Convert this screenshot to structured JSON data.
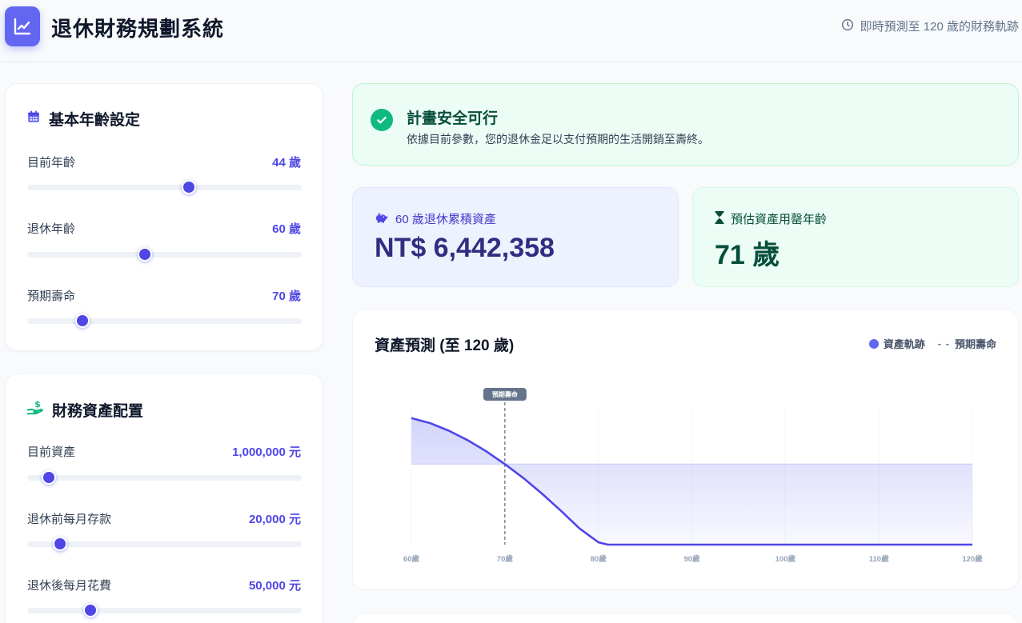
{
  "header": {
    "title": "退休財務規劃系統",
    "subtitle": "即時預測至 120 歲的財務軌跡"
  },
  "age_settings": {
    "title": "基本年齡設定",
    "fields": [
      {
        "label": "目前年齡",
        "value": "44 歲",
        "level": 0.59
      },
      {
        "label": "退休年齡",
        "value": "60 歲",
        "level": 0.43
      },
      {
        "label": "預期壽命",
        "value": "70 歲",
        "level": 0.2
      }
    ]
  },
  "finance_settings": {
    "title": "財務資產配置",
    "fields": [
      {
        "label": "目前資產",
        "value": "1,000,000 元",
        "level": 0.08
      },
      {
        "label": "退休前每月存款",
        "value": "20,000 元",
        "level": 0.12
      },
      {
        "label": "退休後每月花費",
        "value": "50,000 元",
        "level": 0.23
      }
    ]
  },
  "alert": {
    "title": "計畫安全可行",
    "description": "依據目前參數，您的退休金足以支付預期的生活開銷至壽終。"
  },
  "stats": {
    "accumulated": {
      "label": "60  歲退休累積資產",
      "value": "NT$ 6,442,358"
    },
    "depletion": {
      "label": "預估資產用罄年齡",
      "value": "71 歲"
    }
  },
  "chart": {
    "title": "資產預測 (至 120 歲)",
    "legend_series": "資產軌跡",
    "legend_expectancy": "預期壽命",
    "expectancy_tag": "預期壽命"
  },
  "colors": {
    "accent": "#4f46e5",
    "line": "#4f46e5",
    "success": "#10b981"
  },
  "chart_data": {
    "type": "area",
    "x": [
      60,
      62,
      64,
      66,
      68,
      70,
      72,
      74,
      76,
      78,
      80,
      81,
      90,
      100,
      110,
      120
    ],
    "series": [
      {
        "name": "資產軌跡",
        "values": [
          6442358,
          6180000,
          5800000,
          5320000,
          4750000,
          4100000,
          3380000,
          2580000,
          1720000,
          820000,
          120000,
          0,
          0,
          0,
          0,
          0
        ]
      }
    ],
    "xlim": [
      60,
      120
    ],
    "xticks": [
      "60歲",
      "70歲",
      "80歲",
      "90歲",
      "100歲",
      "110歲",
      "120歲"
    ],
    "xtick_values": [
      60,
      70,
      80,
      90,
      100,
      110,
      120
    ],
    "ylim": [
      0,
      7000000
    ],
    "baseline": 4100000,
    "expectancy_x": 70,
    "grid": true,
    "legend": "top-right"
  }
}
